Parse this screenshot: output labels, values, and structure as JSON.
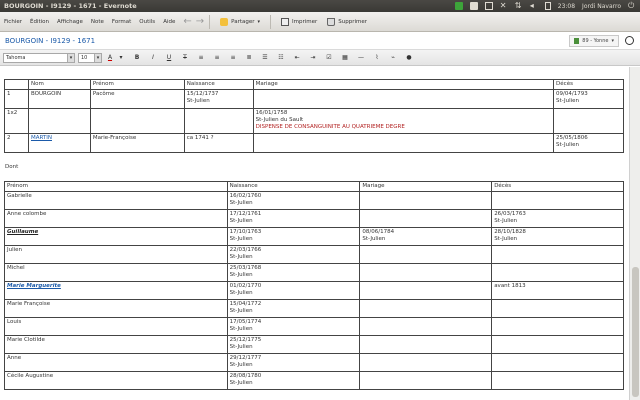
{
  "window": {
    "title": "BOURGOIN - I9129 - 1671 - Evernote"
  },
  "tray": {
    "time": "23:08",
    "user": "Jordi Navarro"
  },
  "menu": [
    "Fichier",
    "Édition",
    "Affichage",
    "Note",
    "Format",
    "Outils",
    "Aide"
  ],
  "toolbar": {
    "share": "Partager",
    "print": "Imprimer",
    "delete": "Supprimer"
  },
  "note": {
    "title": "BOURGOIN - I9129 - 1671",
    "notebook": "89 - Yonne"
  },
  "format": {
    "font": "Tahoma",
    "size": "10"
  },
  "table1": {
    "headers": [
      "",
      "Nom",
      "Prénom",
      "Naissance",
      "Mariage",
      "Décès"
    ],
    "rows": [
      {
        "num": "1",
        "nom": "BOURGOIN",
        "prenom": "Pacôme",
        "naissance": "15/12/1737\nSt-Julien",
        "mariage": "",
        "deces": "09/04/1793\nSt-Julien"
      },
      {
        "num": "1x2",
        "nom": "",
        "prenom": "",
        "naissance": "",
        "mariage": "16/01/1758\nSt-Julien du Sault",
        "mariage_note": "DISPENSE DE CONSANGUINITE AU QUATRIEME DEGRE",
        "deces": ""
      },
      {
        "num": "2",
        "nom": "MARTIN",
        "prenom": "Marie-Françoise",
        "naissance": "ca 1741 ?",
        "mariage": "",
        "deces": "25/05/1806\nSt-Julien"
      }
    ]
  },
  "dont_label": "Dont",
  "table2": {
    "headers": [
      "Prénom",
      "Naissance",
      "Mariage",
      "Décès"
    ],
    "rows": [
      {
        "prenom": "Gabrielle",
        "style": "",
        "naissance": "16/02/1760\nSt-Julien",
        "mariage": "",
        "deces": ""
      },
      {
        "prenom": "Anne colombe",
        "style": "",
        "naissance": "17/12/1761\nSt-Julien",
        "mariage": "",
        "deces": "26/03/1763\nSt-Julien"
      },
      {
        "prenom": "Guillaume",
        "style": "blk",
        "naissance": "17/10/1763\nSt-Julien",
        "mariage": "08/06/1784\nSt-Julien",
        "deces": "28/10/1828\nSt-Julien"
      },
      {
        "prenom": "Julien",
        "style": "",
        "naissance": "22/03/1766\nSt-Julien",
        "mariage": "",
        "deces": ""
      },
      {
        "prenom": "Michel",
        "style": "",
        "naissance": "25/03/1768\nSt-Julien",
        "mariage": "",
        "deces": ""
      },
      {
        "prenom": "Marie Marguerite",
        "style": "blue",
        "naissance": "01/02/1770\nSt-Julien",
        "mariage": "",
        "deces": "avant 1813"
      },
      {
        "prenom": "Marie Françoise",
        "style": "",
        "naissance": "15/04/1772\nSt-Julien",
        "mariage": "",
        "deces": ""
      },
      {
        "prenom": "Louis",
        "style": "",
        "naissance": "17/05/1774\nSt-Julien",
        "mariage": "",
        "deces": ""
      },
      {
        "prenom": "Marie Clotilde",
        "style": "",
        "naissance": "25/12/1775\nSt-Julien",
        "mariage": "",
        "deces": ""
      },
      {
        "prenom": "Anne",
        "style": "",
        "naissance": "29/12/1777\nSt-Julien",
        "mariage": "",
        "deces": ""
      },
      {
        "prenom": "Cécile Augustine",
        "style": "",
        "naissance": "28/08/1780\nSt-Julien",
        "mariage": "",
        "deces": ""
      }
    ]
  }
}
